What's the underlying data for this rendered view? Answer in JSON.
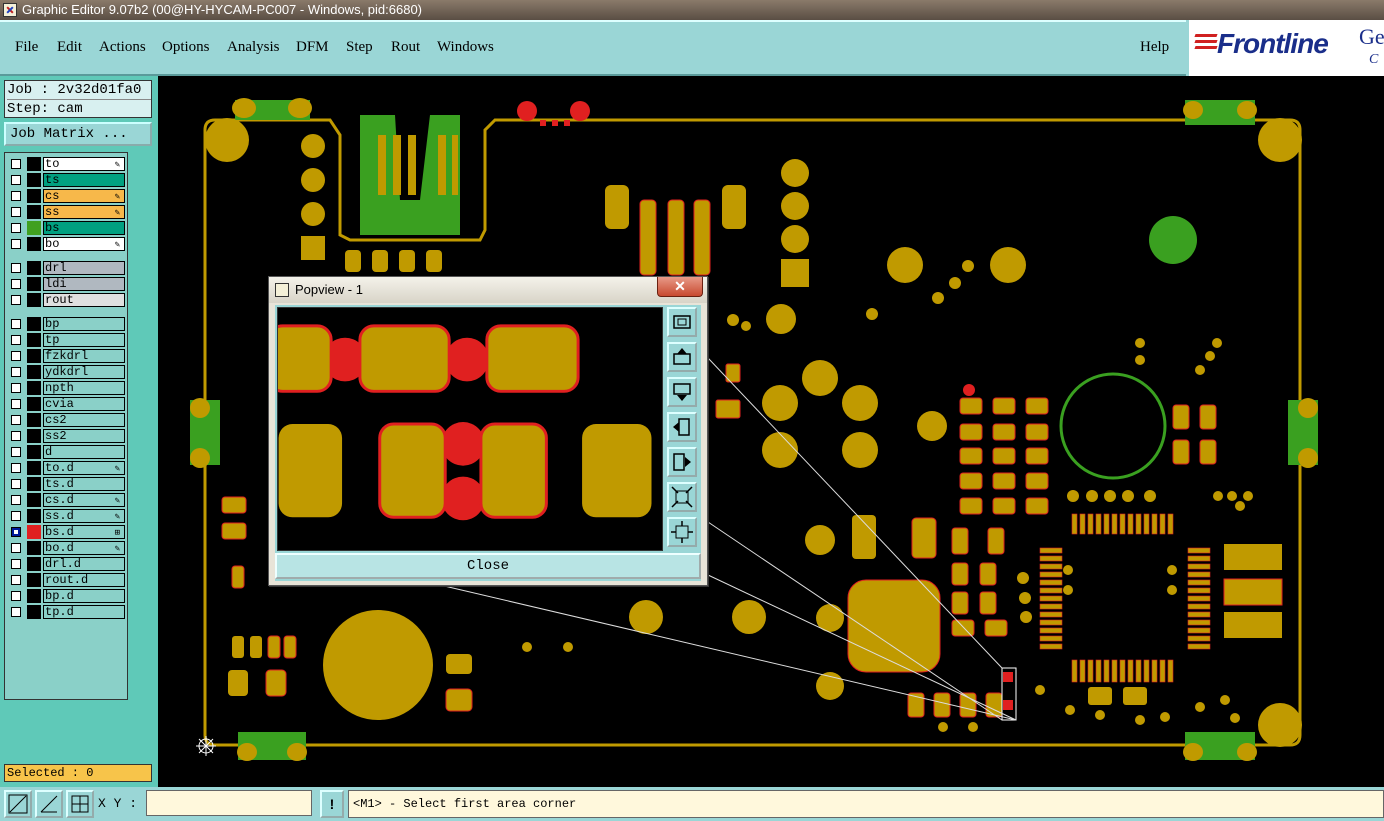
{
  "window": {
    "title": "Graphic Editor 9.07b2 (00@HY-HYCAM-PC007 - Windows, pid:6680)"
  },
  "menu": {
    "items": [
      "File",
      "Edit",
      "Actions",
      "Options",
      "Analysis",
      "DFM",
      "Step",
      "Rout",
      "Windows"
    ],
    "help": "Help"
  },
  "logo": {
    "text": "Frontline",
    "partial": "Ge",
    "partial2": "C"
  },
  "job": {
    "name": "Job : 2v32d01fa0",
    "step": "Step: cam",
    "matrix_button": "Job Matrix ..."
  },
  "layers": [
    {
      "name": "to",
      "fill": "#ffffff",
      "swatch": "#000000",
      "icon": "pen-icon"
    },
    {
      "name": "ts",
      "fill": "#00a080",
      "swatch": "#000000",
      "icon": ""
    },
    {
      "name": "cs",
      "fill": "#f7b84a",
      "swatch": "#000000",
      "icon": "pen-icon"
    },
    {
      "name": "ss",
      "fill": "#f7b84a",
      "swatch": "#000000",
      "icon": "pen-icon"
    },
    {
      "name": "bs",
      "fill": "#00a080",
      "swatch": "#40a020",
      "icon": ""
    },
    {
      "name": "bo",
      "fill": "#ffffff",
      "swatch": "#000000",
      "icon": "pen-icon"
    },
    {
      "name": "drl",
      "fill": "#b0b8c0",
      "swatch": "#000000",
      "icon": ""
    },
    {
      "name": "ldi",
      "fill": "#b0b8c0",
      "swatch": "#000000",
      "icon": ""
    },
    {
      "name": "rout",
      "fill": "#e0e0e0",
      "swatch": "#000000",
      "icon": ""
    },
    {
      "name": "bp",
      "fill": "#8ad0c8",
      "swatch": "#000000",
      "icon": ""
    },
    {
      "name": "tp",
      "fill": "#8ad0c8",
      "swatch": "#000000",
      "icon": ""
    },
    {
      "name": "fzkdrl",
      "fill": "#8ad0c8",
      "swatch": "#000000",
      "icon": ""
    },
    {
      "name": "ydkdrl",
      "fill": "#8ad0c8",
      "swatch": "#000000",
      "icon": ""
    },
    {
      "name": "npth",
      "fill": "#8ad0c8",
      "swatch": "#000000",
      "icon": ""
    },
    {
      "name": "cvia",
      "fill": "#8ad0c8",
      "swatch": "#000000",
      "icon": ""
    },
    {
      "name": "cs2",
      "fill": "#8ad0c8",
      "swatch": "#000000",
      "icon": ""
    },
    {
      "name": "ss2",
      "fill": "#8ad0c8",
      "swatch": "#000000",
      "icon": ""
    },
    {
      "name": "d",
      "fill": "#8ad0c8",
      "swatch": "#000000",
      "icon": ""
    },
    {
      "name": "to.d",
      "fill": "#8ad0c8",
      "swatch": "#000000",
      "icon": "pen-icon"
    },
    {
      "name": "ts.d",
      "fill": "#8ad0c8",
      "swatch": "#000000",
      "icon": ""
    },
    {
      "name": "cs.d",
      "fill": "#8ad0c8",
      "swatch": "#000000",
      "icon": "pen-icon"
    },
    {
      "name": "ss.d",
      "fill": "#8ad0c8",
      "swatch": "#000000",
      "icon": "pen-icon"
    },
    {
      "name": "bs.d",
      "fill": "#8ad0c8",
      "swatch": "#e02020",
      "icon": "grid-icon",
      "checked": true
    },
    {
      "name": "bo.d",
      "fill": "#8ad0c8",
      "swatch": "#000000",
      "icon": "pen-icon"
    },
    {
      "name": "drl.d",
      "fill": "#8ad0c8",
      "swatch": "#000000",
      "icon": ""
    },
    {
      "name": "rout.d",
      "fill": "#8ad0c8",
      "swatch": "#000000",
      "icon": ""
    },
    {
      "name": "bp.d",
      "fill": "#8ad0c8",
      "swatch": "#000000",
      "icon": ""
    },
    {
      "name": "tp.d",
      "fill": "#8ad0c8",
      "swatch": "#000000",
      "icon": ""
    }
  ],
  "selected": "Selected : 0",
  "status": {
    "xy_label": "X Y :",
    "xy_value": "",
    "excl": "!",
    "message": "<M1> - Select first area corner"
  },
  "popview": {
    "title": "Popview - 1",
    "close_x": "✕",
    "close_button": "Close"
  },
  "colors": {
    "pad": "#c09a00",
    "pad_outline": "#e02020",
    "mask": "#3aa020",
    "board": "#000000",
    "panel": "#9ad6d6",
    "left_panel": "#5fc9b8"
  }
}
